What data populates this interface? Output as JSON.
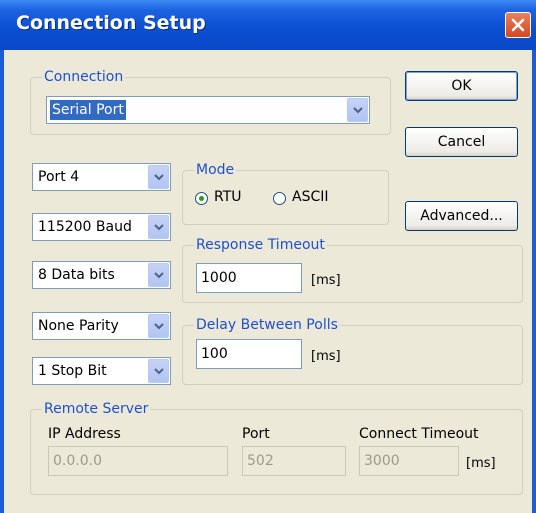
{
  "window": {
    "title": "Connection Setup"
  },
  "connection": {
    "legend": "Connection",
    "type_value": "Serial Port"
  },
  "buttons": {
    "ok": "OK",
    "cancel": "Cancel",
    "advanced": "Advanced..."
  },
  "serial": {
    "port": "Port 4",
    "baud": "115200 Baud",
    "data_bits": "8 Data bits",
    "parity": "None Parity",
    "stop_bits": "1 Stop Bit"
  },
  "mode": {
    "legend": "Mode",
    "options": [
      {
        "label": "RTU",
        "selected": true
      },
      {
        "label": "ASCII",
        "selected": false
      }
    ]
  },
  "response_timeout": {
    "legend": "Response Timeout",
    "value": "1000",
    "unit": "[ms]"
  },
  "delay_between_polls": {
    "legend": "Delay Between Polls",
    "value": "100",
    "unit": "[ms]"
  },
  "remote_server": {
    "legend": "Remote Server",
    "ip_label": "IP Address",
    "ip_value": "0.0.0.0",
    "port_label": "Port",
    "port_value": "502",
    "connect_timeout_label": "Connect Timeout",
    "connect_timeout_value": "3000",
    "unit": "[ms]"
  },
  "colors": {
    "titlebar": "#0a4fd2",
    "client": "#ece9d8",
    "legend_text": "#1f4fd0",
    "selection": "#316ac5"
  }
}
